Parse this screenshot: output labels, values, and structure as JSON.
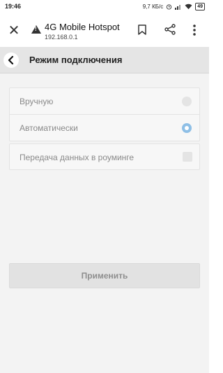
{
  "status_bar": {
    "time": "19:46",
    "speed": "9,7 КБ/с",
    "battery": "49"
  },
  "browser": {
    "title": "4G Mobile Hotspot",
    "url": "192.168.0.1"
  },
  "app": {
    "title": "Режим подключения"
  },
  "connection_mode": {
    "options": [
      {
        "label": "Вручную",
        "selected": false
      },
      {
        "label": "Автоматически",
        "selected": true
      }
    ]
  },
  "roaming": {
    "label": "Передача данных в роуминге",
    "checked": false
  },
  "actions": {
    "apply_label": "Применить"
  },
  "colors": {
    "radio_selected": "#8ebfe6",
    "header_bg": "#e5e5e5",
    "content_bg": "#f3f3f3"
  }
}
